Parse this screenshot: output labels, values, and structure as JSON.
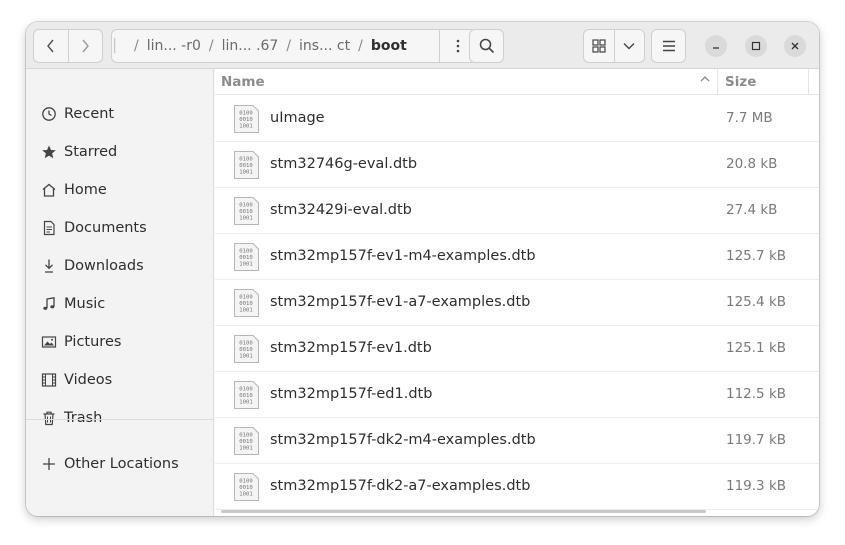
{
  "navigation": {
    "back_icon": "chevron-left-icon",
    "forward_icon": "chevron-right-icon"
  },
  "pathbar": {
    "segments": [
      "lin... -r0",
      "lin... .67",
      "ins... ct",
      "boot"
    ],
    "separator": "/"
  },
  "toolbar": {
    "menu_icon": "vertical-ellipsis-icon",
    "search_icon": "search-icon",
    "grid_view_icon": "grid-view-icon",
    "view_options_icon": "chevron-down-icon",
    "main_menu_icon": "hamburger-menu-icon",
    "minimize_icon": "minimize-icon",
    "maximize_icon": "maximize-icon",
    "close_icon": "close-icon"
  },
  "sidebar": {
    "items": [
      {
        "label": "Recent",
        "icon": "clock-icon"
      },
      {
        "label": "Starred",
        "icon": "star-icon"
      },
      {
        "label": "Home",
        "icon": "home-icon"
      },
      {
        "label": "Documents",
        "icon": "document-icon"
      },
      {
        "label": "Downloads",
        "icon": "download-icon"
      },
      {
        "label": "Music",
        "icon": "music-note-icon"
      },
      {
        "label": "Pictures",
        "icon": "picture-icon"
      },
      {
        "label": "Videos",
        "icon": "film-icon"
      },
      {
        "label": "Trash",
        "icon": "trash-icon"
      }
    ],
    "other_locations": {
      "label": "Other Locations",
      "icon": "plus-icon"
    }
  },
  "file_list": {
    "columns": {
      "name": "Name",
      "size": "Size"
    },
    "sort_icon": "sort-ascending-icon",
    "files": [
      {
        "name": "uImage",
        "size": "7.7 MB"
      },
      {
        "name": "stm32746g-eval.dtb",
        "size": "20.8 kB"
      },
      {
        "name": "stm32429i-eval.dtb",
        "size": "27.4 kB"
      },
      {
        "name": "stm32mp157f-ev1-m4-examples.dtb",
        "size": "125.7 kB"
      },
      {
        "name": "stm32mp157f-ev1-a7-examples.dtb",
        "size": "125.4 kB"
      },
      {
        "name": "stm32mp157f-ev1.dtb",
        "size": "125.1 kB"
      },
      {
        "name": "stm32mp157f-ed1.dtb",
        "size": "112.5 kB"
      },
      {
        "name": "stm32mp157f-dk2-m4-examples.dtb",
        "size": "119.7 kB"
      },
      {
        "name": "stm32mp157f-dk2-a7-examples.dtb",
        "size": "119.3 kB"
      }
    ],
    "file_icon": "binary-file-icon",
    "file_icon_text": [
      "0100",
      "0010",
      "1001"
    ]
  }
}
